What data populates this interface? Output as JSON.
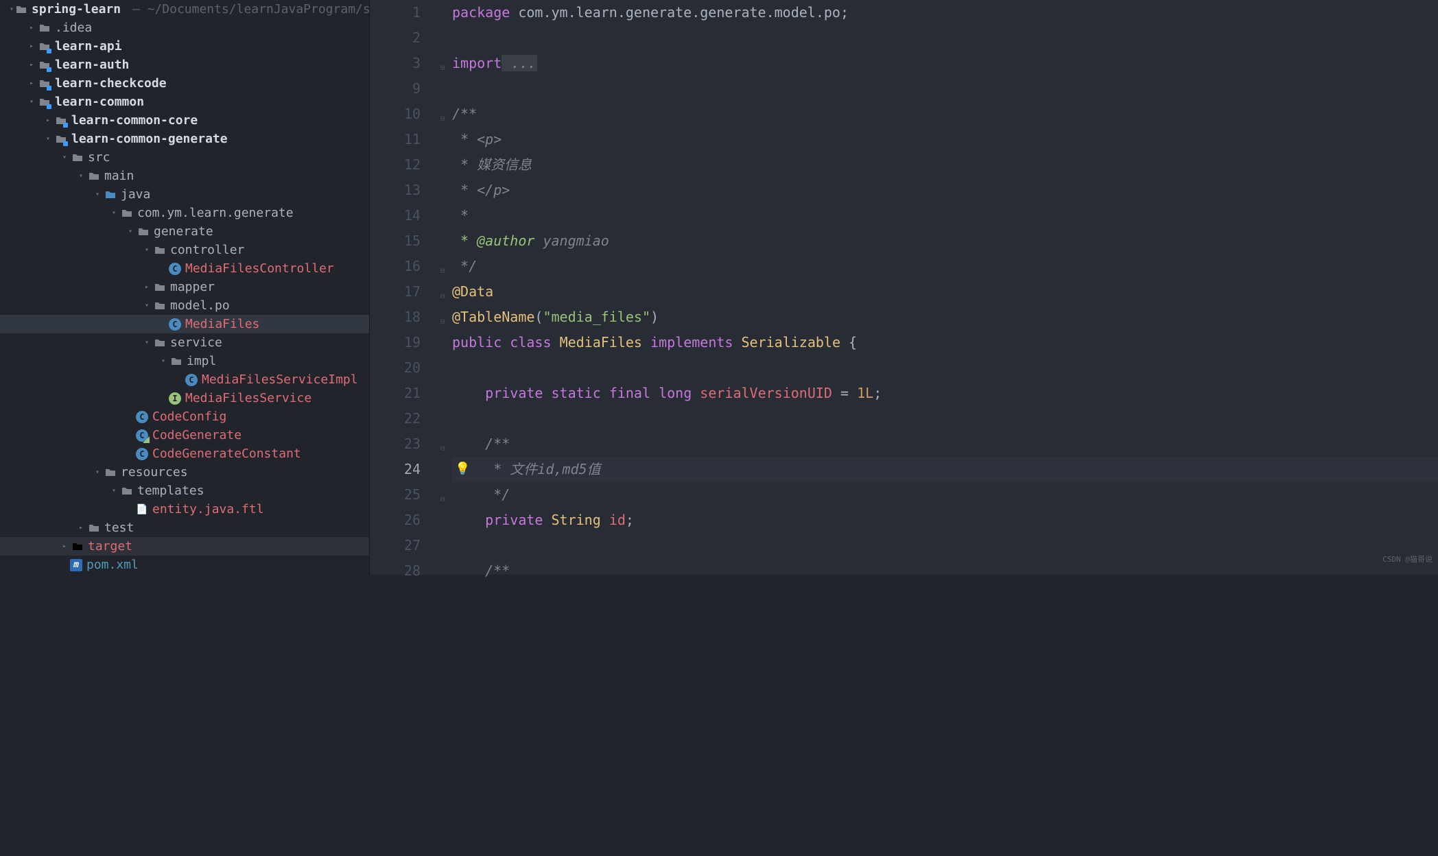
{
  "project": {
    "name": "spring-learn",
    "path": "~/Documents/learnJavaProgram/spring-"
  },
  "tree": {
    "idea": ".idea",
    "learn_api": "learn-api",
    "learn_auth": "learn-auth",
    "learn_checkcode": "learn-checkcode",
    "learn_common": "learn-common",
    "learn_common_core": "learn-common-core",
    "learn_common_generate": "learn-common-generate",
    "src": "src",
    "main": "main",
    "java": "java",
    "package_root": "com.ym.learn.generate",
    "generate": "generate",
    "controller": "controller",
    "MediaFilesController": "MediaFilesController",
    "mapper": "mapper",
    "model_po": "model.po",
    "MediaFiles": "MediaFiles",
    "service": "service",
    "impl": "impl",
    "MediaFilesServiceImpl": "MediaFilesServiceImpl",
    "MediaFilesService": "MediaFilesService",
    "CodeConfig": "CodeConfig",
    "CodeGenerate": "CodeGenerate",
    "CodeGenerateConstant": "CodeGenerateConstant",
    "resources": "resources",
    "templates": "templates",
    "entity_ftl": "entity.java.ftl",
    "test": "test",
    "target": "target",
    "pom": "pom.xml"
  },
  "editor": {
    "lines": [
      "1",
      "2",
      "3",
      "9",
      "10",
      "11",
      "12",
      "13",
      "14",
      "15",
      "16",
      "17",
      "18",
      "19",
      "20",
      "21",
      "22",
      "23",
      "24",
      "25",
      "26",
      "27",
      "28"
    ],
    "current_line_index": 18
  },
  "code": {
    "package_kw": "package",
    "package_name": " com.ym.learn.generate.generate.model.po;",
    "import_kw": "import",
    "import_ellipsis": " ...",
    "doc_open": "/**",
    "doc_p_open": " * <p>",
    "doc_desc": " * 媒资信息",
    "doc_p_close": " * </p>",
    "doc_star": " *",
    "doc_author_tag": " * @author",
    "doc_author_name": " yangmiao",
    "doc_close": " */",
    "anno_data": "@Data",
    "anno_table": "@TableName",
    "anno_table_paren_open": "(",
    "anno_table_arg": "\"media_files\"",
    "anno_table_paren_close": ")",
    "kw_public": "public",
    "kw_class": "class",
    "cls_name": "MediaFiles",
    "kw_implements": "implements",
    "iface": "Serializable",
    "brace": "{",
    "kw_private": "private",
    "kw_static": "static",
    "kw_final": "final",
    "kw_long": "long",
    "fld_uid": "serialVersionUID",
    "eq": "=",
    "val_1L": "1L",
    "semi": ";",
    "doc2_open": "/**",
    "doc2_body": " * 文件id,md5值",
    "doc2_close": " */",
    "type_string": "String",
    "fld_id": "id",
    "doc3_open": "/**"
  },
  "watermark": "CSDN @猫哥说"
}
